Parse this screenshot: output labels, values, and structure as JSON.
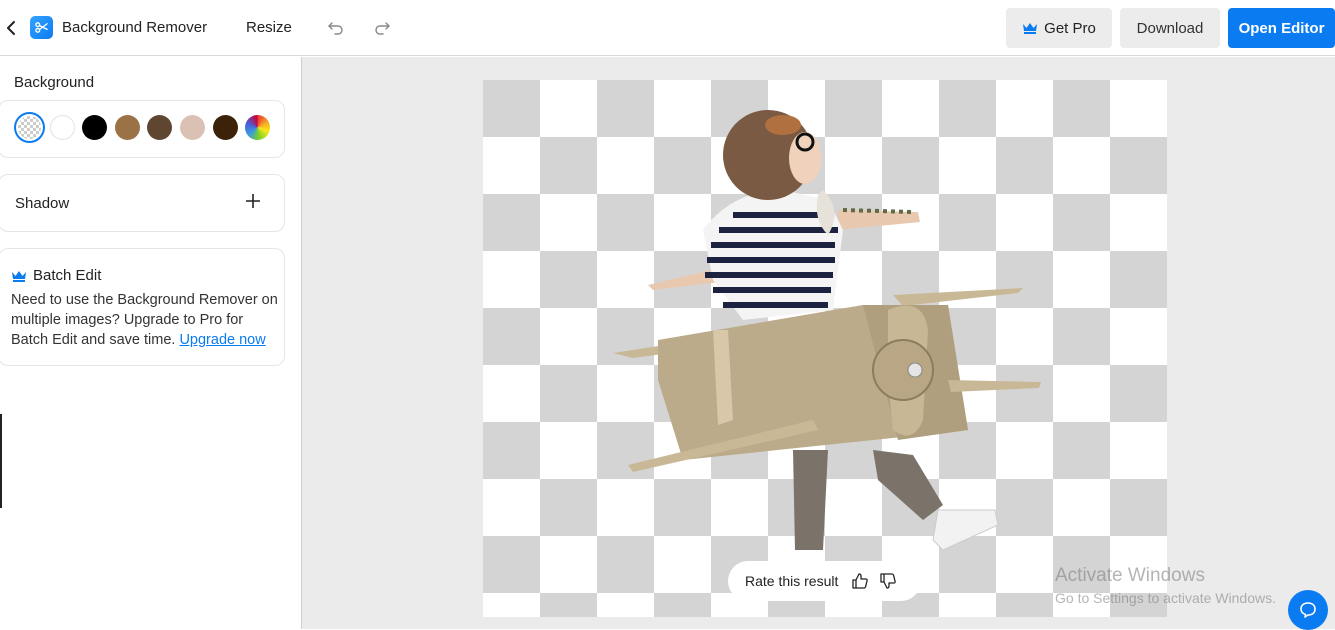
{
  "header": {
    "app_title": "Background Remover",
    "resize_label": "Resize",
    "get_pro_label": "Get Pro",
    "download_label": "Download",
    "open_editor_label": "Open Editor"
  },
  "sidebar": {
    "background_label": "Background",
    "swatches": [
      {
        "name": "transparent",
        "color": "transparent",
        "selected": true
      },
      {
        "name": "white",
        "color": "#ffffff"
      },
      {
        "name": "black",
        "color": "#000000"
      },
      {
        "name": "tan",
        "color": "#9a7246"
      },
      {
        "name": "dark-brown",
        "color": "#5e4631"
      },
      {
        "name": "beige",
        "color": "#dbc1b4"
      },
      {
        "name": "espresso",
        "color": "#3b2208"
      },
      {
        "name": "custom-color",
        "color": "rainbow"
      }
    ],
    "shadow_label": "Shadow",
    "batch": {
      "title": "Batch Edit",
      "text": "Need to use the Background Remover on multiple images? Upgrade to Pro for Batch Edit and save time.",
      "link": "Upgrade now"
    }
  },
  "canvas": {
    "subject_description": "Child in aviator hat and striped shirt wearing a cardboard airplane, background removed"
  },
  "rating": {
    "label": "Rate this result"
  },
  "system": {
    "watermark_title": "Activate Windows",
    "watermark_subtitle": "Go to Settings to activate Windows."
  },
  "colors": {
    "accent": "#0b7bf1",
    "button_gray": "#ececec",
    "workspace_bg": "#ebebeb",
    "checker_dark": "#d4d4d4"
  }
}
